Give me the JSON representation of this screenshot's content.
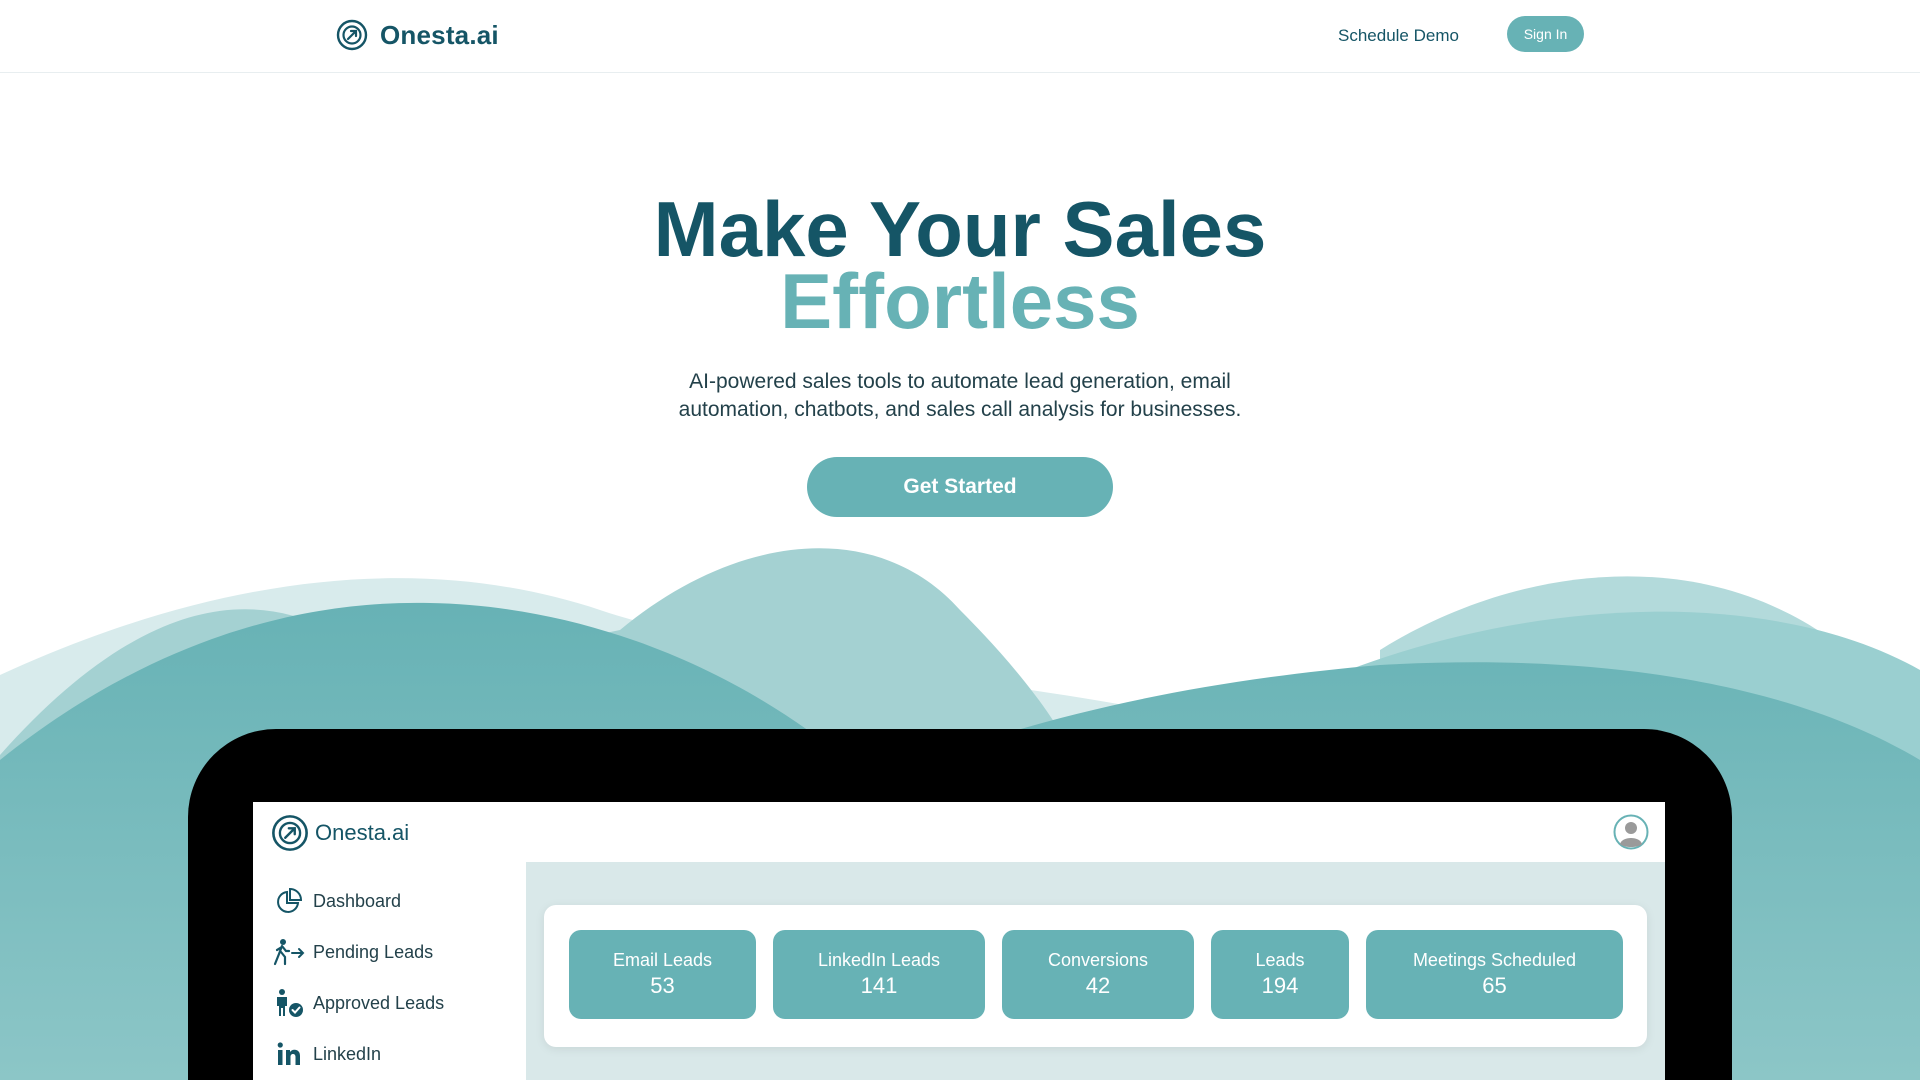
{
  "nav": {
    "brand": "Onesta.ai",
    "schedule_demo": "Schedule Demo",
    "sign_in": "Sign In"
  },
  "hero": {
    "title_line1": "Make Your Sales",
    "title_line2": "Effortless",
    "subtitle_line1": "AI-powered sales tools to automate lead generation, email",
    "subtitle_line2": "automation, chatbots, and sales call analysis for businesses.",
    "cta": "Get Started"
  },
  "app": {
    "brand": "Onesta.ai",
    "sidebar": {
      "items": [
        {
          "label": "Dashboard",
          "icon": "pie-chart-icon"
        },
        {
          "label": "Pending Leads",
          "icon": "walking-person-icon"
        },
        {
          "label": "Approved Leads",
          "icon": "person-check-icon"
        },
        {
          "label": "LinkedIn",
          "icon": "linkedin-icon"
        }
      ]
    },
    "stats": [
      {
        "label": "Email Leads",
        "value": "53"
      },
      {
        "label": "LinkedIn Leads",
        "value": "141"
      },
      {
        "label": "Conversions",
        "value": "42"
      },
      {
        "label": "Leads",
        "value": "194"
      },
      {
        "label": "Meetings Scheduled",
        "value": "65"
      }
    ]
  },
  "colors": {
    "primary_dark": "#155566",
    "accent_teal": "#67b2b5",
    "dashboard_bg": "#d9e8e9",
    "device_frame": "#000000"
  }
}
